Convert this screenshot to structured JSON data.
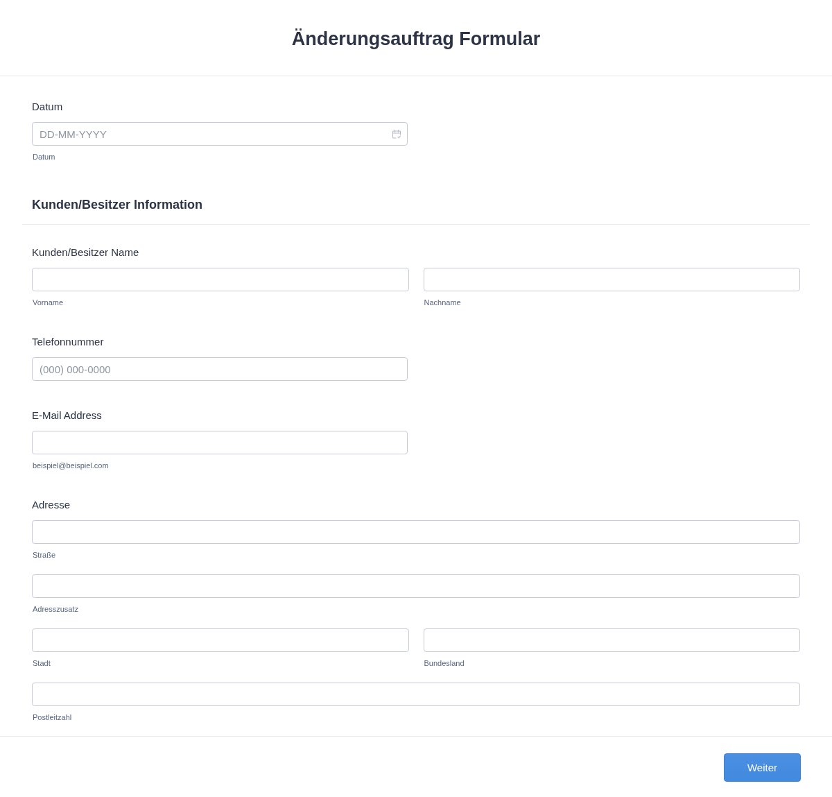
{
  "title": "Änderungsauftrag Formular",
  "fields": [
    {
      "kind": "date",
      "label": "Datum",
      "rows": [
        [
          {
            "placeholder": "DD-MM-YYYY",
            "sublabel": "Datum"
          }
        ]
      ]
    }
  ],
  "section": {
    "heading": "Kunden/Besitzer Information",
    "fields": [
      {
        "kind": "name",
        "label": "Kunden/Besitzer Name",
        "rows": [
          [
            {
              "sublabel": "Vorname"
            },
            {
              "sublabel": "Nachname"
            }
          ]
        ]
      },
      {
        "kind": "phone",
        "label": "Telefonnummer",
        "rows": [
          [
            {
              "placeholder": "(000) 000-0000"
            }
          ]
        ]
      },
      {
        "kind": "email",
        "label": "E-Mail Address",
        "rows": [
          [
            {
              "sublabel": "beispiel@beispiel.com"
            }
          ]
        ]
      },
      {
        "kind": "address",
        "label": "Adresse",
        "rows": [
          [
            {
              "sublabel": "Straße"
            }
          ],
          [
            {
              "sublabel": "Adresszusatz"
            }
          ],
          [
            {
              "sublabel": "Stadt"
            },
            {
              "sublabel": "Bundesland"
            }
          ],
          [
            {
              "sublabel": "Postleitzahl"
            }
          ]
        ]
      }
    ]
  },
  "footer": {
    "button": "Weiter"
  }
}
